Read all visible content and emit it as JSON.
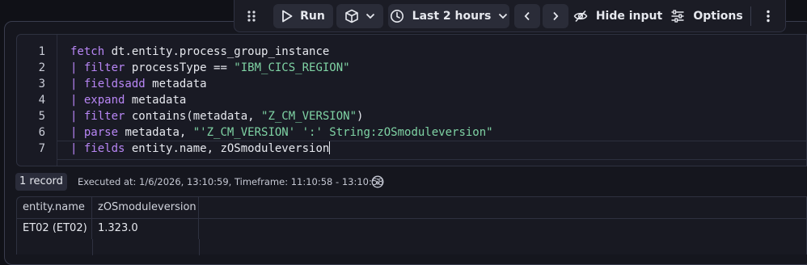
{
  "toolbar": {
    "run_label": "Run",
    "timeframe_label": "Last 2 hours",
    "hide_input_label": "Hide input",
    "options_label": "Options",
    "icons": [
      "drag-handle-icon",
      "play-icon",
      "cube-icon",
      "chevron-down-icon",
      "clock-icon",
      "chevron-left-icon",
      "chevron-right-icon",
      "eye-off-icon",
      "sliders-icon",
      "more-vertical-icon"
    ]
  },
  "editor": {
    "line_numbers": [
      "1",
      "2",
      "3",
      "4",
      "5",
      "6",
      "7"
    ],
    "lines": [
      {
        "keyword": "fetch",
        "rest": " dt.entity.process_group_instance",
        "string": ""
      },
      {
        "keyword": "| filter",
        "rest": " processType == ",
        "string": "\"IBM_CICS_REGION\""
      },
      {
        "keyword": "| fieldsadd",
        "rest": " metadata",
        "string": ""
      },
      {
        "keyword": "| expand",
        "rest": " metadata",
        "string": ""
      },
      {
        "keyword": "| filter",
        "rest": " contains(metadata, ",
        "string": "\"Z_CM_VERSION\"",
        "tail": ")"
      },
      {
        "keyword": "| parse",
        "rest": " metadata, ",
        "string": "\"'Z_CM_VERSION' ':' String:zOSmoduleversion\""
      },
      {
        "keyword": "| fields",
        "rest": " entity.name, zOSmoduleversion",
        "string": ""
      }
    ]
  },
  "status": {
    "record_count": "1 record",
    "executed_info": "Executed at: 1/6/2026, 13:10:59, Timeframe: 11:10:58 - 13:10:58"
  },
  "table": {
    "columns": [
      "entity.name",
      "zOSmoduleversion"
    ],
    "rows": [
      [
        "ET02 (ET02)",
        "1.323.0"
      ]
    ]
  },
  "colors": {
    "background": "#101117",
    "keyword": "#b886f5",
    "string": "#7fd3a4",
    "text": "#e6e8ee"
  }
}
